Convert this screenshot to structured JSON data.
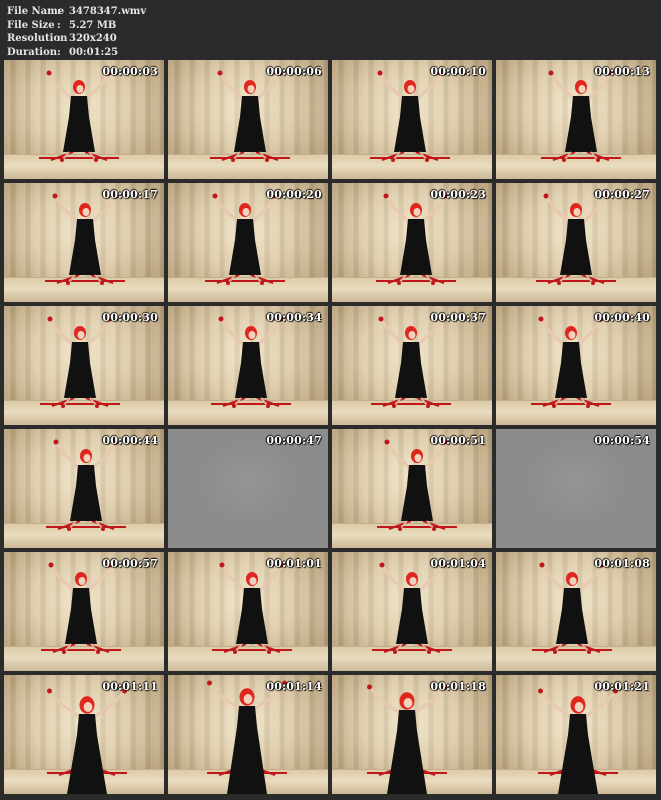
{
  "info": {
    "file_name_label": "File Name",
    "file_name": "3478347.wmv",
    "file_size_label": "File Size",
    "file_size": "5.27 MB",
    "resolution_label": "Resolution",
    "resolution": "320x240",
    "duration_label": "Duration",
    "duration": "00:01:25"
  },
  "thumbnails": [
    {
      "time": "00:00:03",
      "kind": "frame"
    },
    {
      "time": "00:00:06",
      "kind": "frame"
    },
    {
      "time": "00:00:10",
      "kind": "frame"
    },
    {
      "time": "00:00:13",
      "kind": "frame"
    },
    {
      "time": "00:00:17",
      "kind": "frame"
    },
    {
      "time": "00:00:20",
      "kind": "frame"
    },
    {
      "time": "00:00:23",
      "kind": "frame"
    },
    {
      "time": "00:00:27",
      "kind": "frame"
    },
    {
      "time": "00:00:30",
      "kind": "frame"
    },
    {
      "time": "00:00:34",
      "kind": "frame"
    },
    {
      "time": "00:00:37",
      "kind": "frame"
    },
    {
      "time": "00:00:40",
      "kind": "frame"
    },
    {
      "time": "00:00:44",
      "kind": "frame"
    },
    {
      "time": "00:00:47",
      "kind": "gray"
    },
    {
      "time": "00:00:51",
      "kind": "frame"
    },
    {
      "time": "00:00:54",
      "kind": "gray"
    },
    {
      "time": "00:00:57",
      "kind": "frame"
    },
    {
      "time": "00:01:01",
      "kind": "frame"
    },
    {
      "time": "00:01:04",
      "kind": "frame"
    },
    {
      "time": "00:01:08",
      "kind": "frame"
    },
    {
      "time": "00:01:11",
      "kind": "frame"
    },
    {
      "time": "00:01:14",
      "kind": "frame"
    },
    {
      "time": "00:01:18",
      "kind": "frame"
    },
    {
      "time": "00:01:21",
      "kind": "frame"
    }
  ],
  "colors": {
    "background": "#2b2b2b",
    "info_text": "#e6e6e6",
    "hair": "#e0261d",
    "dress": "#111111",
    "straps": "#c0181a",
    "gray_frame": "#8c8c8c"
  }
}
